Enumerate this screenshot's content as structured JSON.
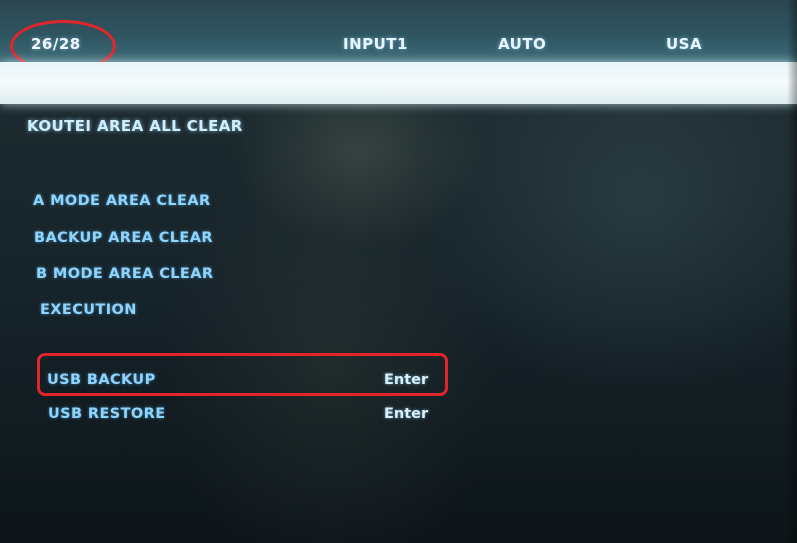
{
  "header": {
    "page_counter": "26/28",
    "input_source": "INPUT1",
    "mode": "AUTO",
    "region": "USA"
  },
  "menu": {
    "title": "KOUTEI AREA ALL CLEAR",
    "items": [
      {
        "label": "A MODE AREA CLEAR"
      },
      {
        "label": "BACKUP AREA CLEAR"
      },
      {
        "label": "B MODE AREA CLEAR"
      },
      {
        "label": "EXECUTION"
      }
    ],
    "usb_items": [
      {
        "label": "USB BACKUP",
        "value": "Enter"
      },
      {
        "label": "USB RESTORE",
        "value": "Enter"
      }
    ]
  },
  "colors": {
    "menu_text": "#8fd4ff",
    "highlight_band": "#f6fbfc",
    "annotation_red": "#e0262a"
  }
}
